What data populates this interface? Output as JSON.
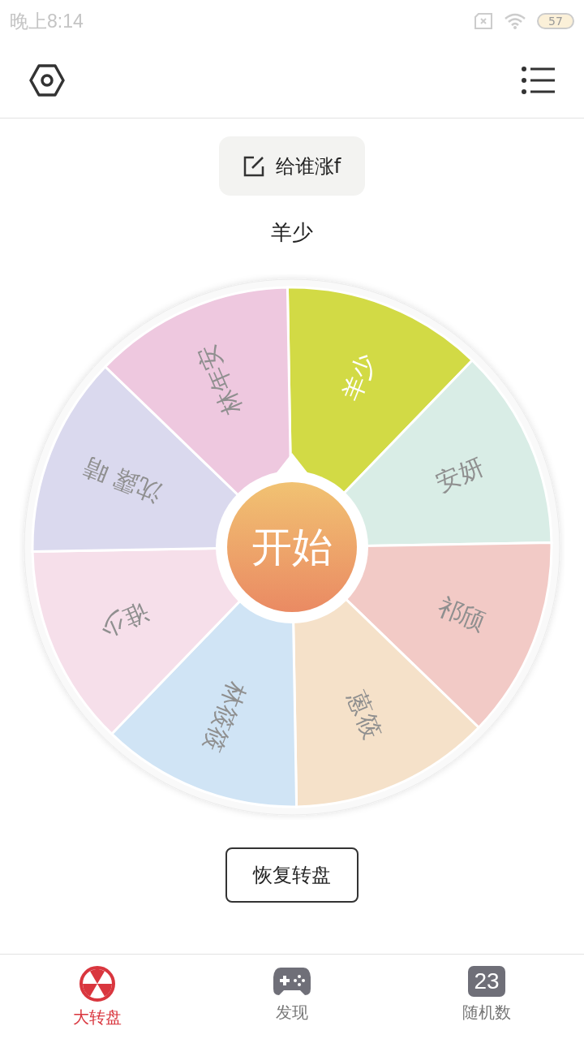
{
  "status_bar": {
    "time": "晚上8:14",
    "battery": "57"
  },
  "edit_button": {
    "label": "给谁涨f"
  },
  "result": "羊少",
  "wheel": {
    "start_button": "开始",
    "segments": [
      {
        "label": "羊少",
        "color": "#d2da45",
        "selected": true
      },
      {
        "label": "安妍",
        "color": "#d9ede6",
        "selected": false
      },
      {
        "label": "祁颀",
        "color": "#f2cac6",
        "selected": false
      },
      {
        "label": "蒽筱",
        "color": "#f5e1c9",
        "selected": false
      },
      {
        "label": "林筱筱",
        "color": "#d0e4f5",
        "selected": false
      },
      {
        "label": "谁少",
        "color": "#f6dfea",
        "selected": false
      },
      {
        "label": "沈露 晴",
        "color": "#dad9ee",
        "selected": false
      },
      {
        "label": "林年安",
        "color": "#eec8df",
        "selected": false
      }
    ]
  },
  "reset_button": "恢复转盘",
  "tabs": [
    {
      "label": "大转盘",
      "kind": "wheel",
      "selected": true
    },
    {
      "label": "发现",
      "kind": "gamepad",
      "selected": false
    },
    {
      "label": "随机数",
      "kind": "number",
      "badge": "23",
      "selected": false
    }
  ]
}
